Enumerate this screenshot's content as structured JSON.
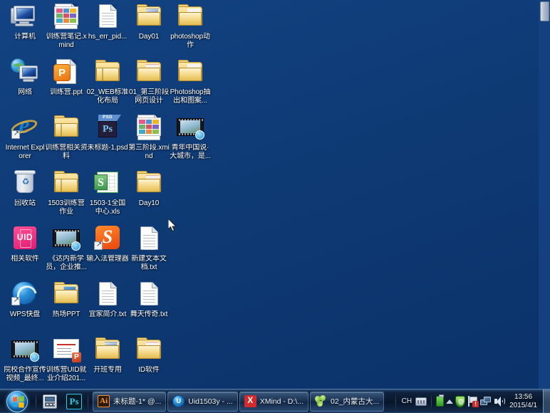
{
  "desktop": {
    "background_color": "#0d3a77",
    "icons": [
      {
        "label": "计算机",
        "art": "pc",
        "shortcut": false
      },
      {
        "label": "训练营笔记.xmind",
        "art": "xmind",
        "shortcut": false
      },
      {
        "label": "hs_err_pid...",
        "art": "doc",
        "shortcut": false
      },
      {
        "label": "Day01",
        "art": "folder-blue",
        "shortcut": false
      },
      {
        "label": "photoshop动作",
        "art": "folder-paper",
        "shortcut": false
      },
      {
        "label": "网络",
        "art": "net",
        "shortcut": false
      },
      {
        "label": "训练营.ppt",
        "art": "ppt-doc",
        "shortcut": false
      },
      {
        "label": "02_WEB标准化布局",
        "art": "folder-plain",
        "shortcut": false
      },
      {
        "label": "01_第三阶段网页设计",
        "art": "folder-red",
        "shortcut": false
      },
      {
        "label": "Photoshop抽出和图案...",
        "art": "folder-paper",
        "shortcut": false
      },
      {
        "label": "Internet Explorer",
        "art": "ie",
        "shortcut": true
      },
      {
        "label": "训练营相关资料",
        "art": "folder-plain",
        "shortcut": false
      },
      {
        "label": "未标题-1.psd",
        "art": "psd",
        "shortcut": false
      },
      {
        "label": "第三阶段.xmind",
        "art": "xmind",
        "shortcut": false
      },
      {
        "label": "青年中国说·大城市，是...",
        "art": "video",
        "shortcut": false
      },
      {
        "label": "回收站",
        "art": "bin",
        "shortcut": false
      },
      {
        "label": "1503训练营作业",
        "art": "folder-plain",
        "shortcut": false
      },
      {
        "label": "1503-1全国中心.xls",
        "art": "xls",
        "shortcut": false
      },
      {
        "label": "Day10",
        "art": "folder-red",
        "shortcut": false
      },
      {
        "label": "相关软件",
        "art": "uid",
        "shortcut": false
      },
      {
        "label": "《达内新学员，企业推...",
        "art": "video",
        "shortcut": false
      },
      {
        "label": "输入法管理器",
        "art": "sogou",
        "shortcut": true
      },
      {
        "label": "新建文本文档.txt",
        "art": "doc",
        "shortcut": false
      },
      {
        "label": "WPS快盘",
        "art": "wps",
        "shortcut": true
      },
      {
        "label": "热场PPT",
        "art": "folder-photo",
        "shortcut": false
      },
      {
        "label": "宜家简介.txt",
        "art": "doc",
        "shortcut": false
      },
      {
        "label": "舞天传奇.txt",
        "art": "doc",
        "shortcut": false
      },
      {
        "label": "院校合作宣传视频_最终...",
        "art": "video",
        "shortcut": false
      },
      {
        "label": "训练营UID就业介绍201...",
        "art": "slide",
        "shortcut": false
      },
      {
        "label": "开班专用",
        "art": "folder-blue",
        "shortcut": false
      },
      {
        "label": "ID软件",
        "art": "folder-red",
        "shortcut": false
      }
    ]
  },
  "taskbar": {
    "start_label": "开始",
    "quick_launch": [
      {
        "name": "calculator",
        "label": "计算器"
      },
      {
        "name": "photoshop",
        "label": "Ps"
      }
    ],
    "task_buttons": [
      {
        "icon": "Ai",
        "label": "未标题-1* @..."
      },
      {
        "icon": "U",
        "label": "Uid1503y - ..."
      },
      {
        "icon": "X",
        "label": "XMind - D:\\..."
      },
      {
        "icon": "leaf",
        "label": "02_内蒙古大..."
      }
    ],
    "tray": {
      "ime_label": "CH",
      "icons": [
        "keyboard-icon",
        "battery-icon",
        "show-hidden-icons-icon",
        "security-shield-icon",
        "flag-action-center-icon",
        "network-icon",
        "volume-icon"
      ]
    },
    "clock": {
      "time": "13:56",
      "date": "2015/4/1"
    }
  }
}
